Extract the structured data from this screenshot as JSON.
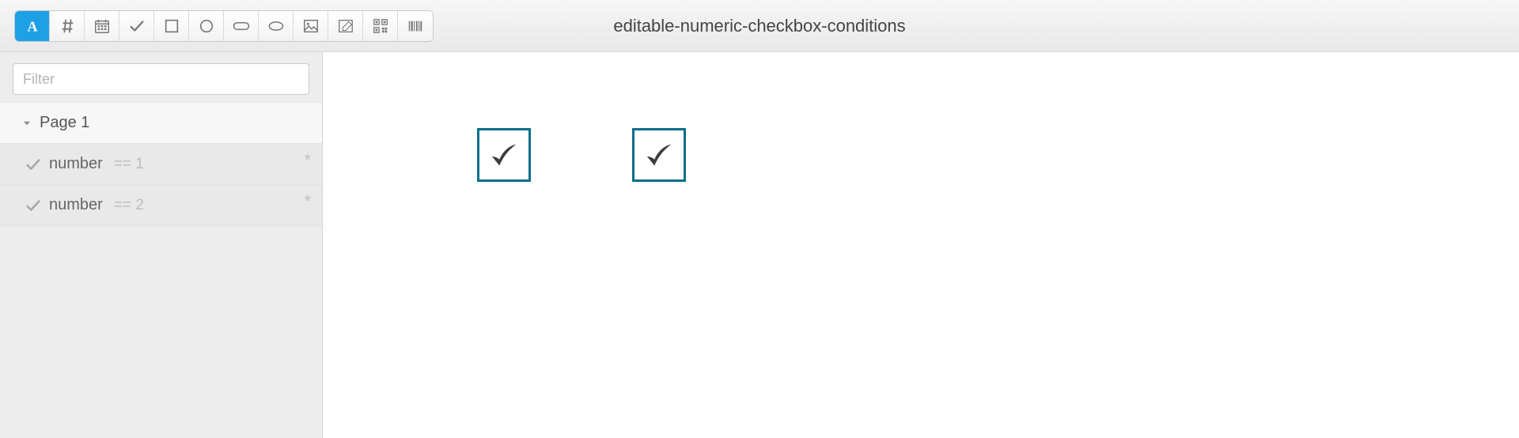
{
  "title": "editable-numeric-checkbox-conditions",
  "toolbar": {
    "items": [
      {
        "name": "text-tool",
        "active": true
      },
      {
        "name": "hash-tool",
        "active": false
      },
      {
        "name": "calendar-tool",
        "active": false
      },
      {
        "name": "check-tool",
        "active": false
      },
      {
        "name": "square-tool",
        "active": false
      },
      {
        "name": "circle-tool",
        "active": false
      },
      {
        "name": "rounded-rect-tool",
        "active": false
      },
      {
        "name": "ellipse-tool",
        "active": false
      },
      {
        "name": "image-tool",
        "active": false
      },
      {
        "name": "signature-tool",
        "active": false
      },
      {
        "name": "qrcode-tool",
        "active": false
      },
      {
        "name": "barcode-tool",
        "active": false
      }
    ]
  },
  "sidebar": {
    "filter_placeholder": "Filter",
    "page_label": "Page 1",
    "items": [
      {
        "label": "number",
        "condition": "== 1"
      },
      {
        "label": "number",
        "condition": "== 2"
      }
    ]
  },
  "canvas": {
    "checkboxes": [
      {
        "checked": true
      },
      {
        "checked": true
      }
    ]
  }
}
